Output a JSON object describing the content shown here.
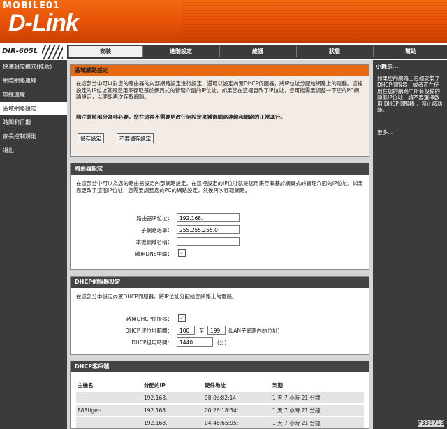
{
  "brand": {
    "top": "MOBILE01",
    "main": "D-Link",
    "model": "DIR-605L"
  },
  "tabs": [
    "安裝",
    "進階設定",
    "維護",
    "狀態",
    "幫助"
  ],
  "sidebar": [
    "快速設定模式(推薦)",
    "網際網路連線",
    "無線連線",
    "區域網路設定",
    "時間和日期",
    "家長控制規則",
    "退出"
  ],
  "help": {
    "title": "小提示...",
    "text": "如果您的網路上已經安裝了DHCP伺服器，或者正在使用在您的網路中所有設備的靜態IP位址，請不要選擇啟用 DHCP伺服器 ，禁止該功能。",
    "more": "更多..."
  },
  "lan": {
    "title": "區域網路設定",
    "desc": "在這部分中可以對您的路由器的內部網路設定進行設定，還可以設定內置DHCP伺服器，將IP位址分配給網路上的電腦。這裡設定的IP位址就是您用來存取基於網頁式的管理介面的IP位址。如果您在這裡更改了IP位址，您可能需要調整一下您的PC網路設定，以便能再次存取網路。",
    "warning": "請注意該部分為非必要，您在這裡不需要更改任何設定來獲得網路連線和網路的正常運行。",
    "save": "儲存設定",
    "nosave": "不要儲存設定"
  },
  "router": {
    "title": "路由器設定",
    "desc": "在這部分中可以為您的路由器設定內部網路設定。在這裡設定的IP位址就是您用來存取基於網頁式的管理介面的IP位址。如果您更改了這個IP位址，您需要調整您的PC的網路設定，然後再次存取網路。",
    "ip_label": "路由器IP位址：",
    "ip_value": "192.168.",
    "mask_label": "子網路遮罩：",
    "mask_value": "255.255.255.0",
    "domain_label": "本機網域名稱：",
    "domain_value": "",
    "dns_label": "啟用DNS中繼：",
    "dns_checked": true
  },
  "dhcp": {
    "title": "DHCP伺服器設定",
    "desc": "在這部分中設定內置DHCP伺服器，將IP位址分配給您網路上的電腦。",
    "enable_label": "啟用DHCP伺服器：",
    "enable_checked": true,
    "range_label": "DHCP IP位址範圍：",
    "range_start": "100",
    "range_to": "至",
    "range_end": "199",
    "range_note": "(LAN子網路內的位址)",
    "lease_label": "DHCP租用時間：",
    "lease_value": "1440",
    "lease_unit": "(分)"
  },
  "clients": {
    "title": "DHCP客戶端",
    "headers": [
      "主機名",
      "分配的IP",
      "硬件地址",
      "到期"
    ],
    "rows": [
      [
        "--",
        "192.168.",
        "98:0c:82:14:",
        "1 天 7 小時 21 分鐘"
      ],
      [
        "888tiger-",
        "192.168.",
        "00:26:18:34:",
        "1 天 7 小時 21 分鐘"
      ],
      [
        "--",
        "192.168.",
        "04:46:65:95:",
        "1 天 7 小時 21 分鐘"
      ]
    ]
  },
  "watermark": "#336713"
}
